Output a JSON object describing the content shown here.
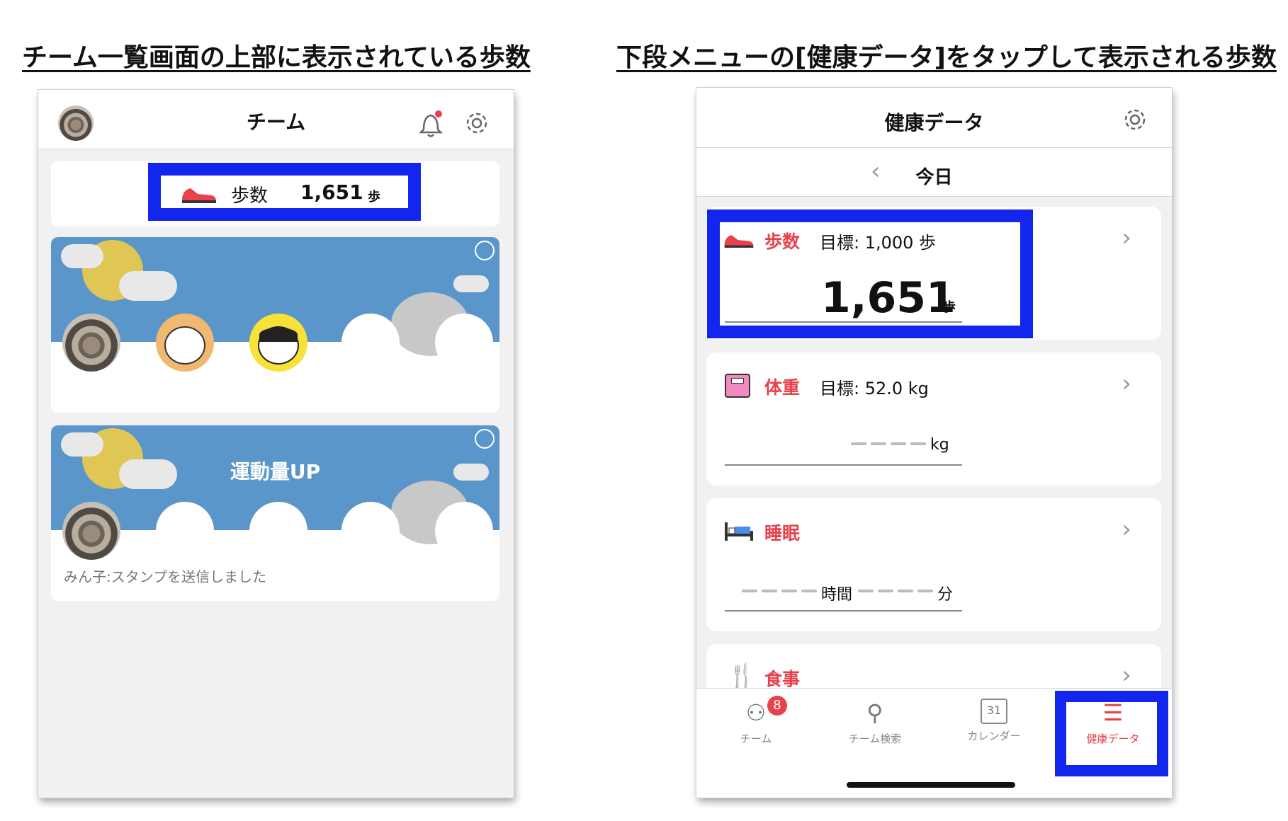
{
  "headings": {
    "left": "チーム一覧画面の上部に表示されている歩数",
    "right": "下段メニューの[健康データ]をタップして表示される歩数"
  },
  "team_screen": {
    "title": "チーム",
    "steps_label": "歩数",
    "steps_value": "1,651",
    "steps_unit": "歩",
    "team2_name": "運動量UP",
    "team2_message": "みん子:スタンプを送信しました"
  },
  "health_screen": {
    "title": "健康データ",
    "day_label": "今日",
    "steps": {
      "label": "歩数",
      "goal": "目標: 1,000 歩",
      "value": "1,651",
      "unit": "歩"
    },
    "weight": {
      "label": "体重",
      "goal": "目標: 52.0 kg",
      "unit": "kg"
    },
    "sleep": {
      "label": "睡眠",
      "unit_hours": "時間",
      "unit_minutes": "分"
    },
    "meal": {
      "label": "食事"
    },
    "tabs": [
      {
        "label": "チーム",
        "badge": "8"
      },
      {
        "label": "チーム検索"
      },
      {
        "label": "カレンダー",
        "icon_text": "31"
      },
      {
        "label": "健康データ"
      }
    ]
  },
  "colors": {
    "accent_red": "#e8414a",
    "highlight_blue": "#1226ee",
    "banner_blue": "#5b96cb"
  }
}
